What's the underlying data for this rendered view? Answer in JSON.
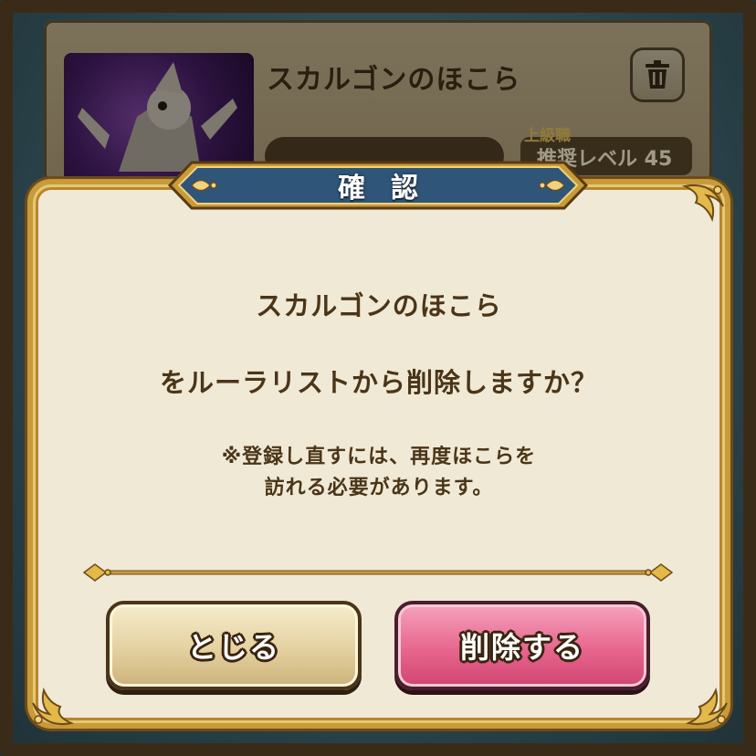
{
  "background": {
    "card_title": "スカルゴンのほこら",
    "rank_label": "上級職",
    "level_text": "推奨レベル 45",
    "trash_icon": "trash-icon",
    "thumbnail_icon": "skeleton-dragon-icon"
  },
  "dialog": {
    "title": "確認",
    "message_line1": "スカルゴンのほこら",
    "message_line2": "をルーラリストから削除しますか？",
    "note_line1": "※登録し直すには、再度ほこらを",
    "note_line2": "訪れる必要があります。",
    "close_button": "とじる",
    "delete_button": "削除する"
  },
  "colors": {
    "accent_gold": "#c79a3a",
    "delete_pink": "#e7668e",
    "panel_bg": "#f0e9d6",
    "banner_blue": "#2f5579",
    "text_brown": "#4a3518"
  }
}
